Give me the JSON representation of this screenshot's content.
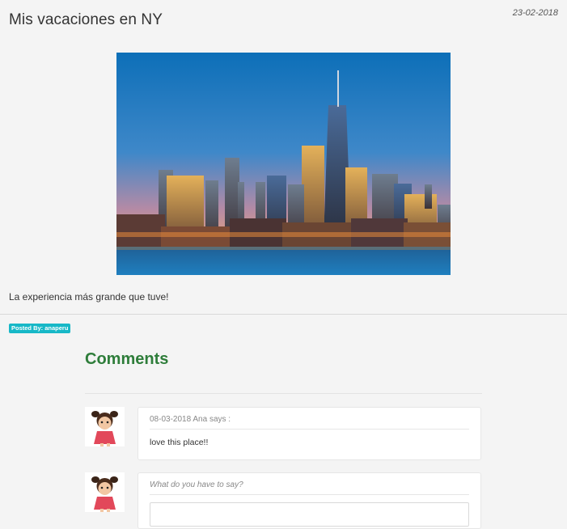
{
  "post": {
    "title": "Mis vacaciones en NY",
    "date": "23-02-2018",
    "image_alt": "New York City skyline at dusk",
    "body": "La experiencia más grande que tuve!",
    "posted_by": "Posted By: anaperu"
  },
  "comments": {
    "title": "Comments",
    "items": [
      {
        "meta": "08-03-2018 Ana says :",
        "text": "love this place!!"
      }
    ],
    "new_comment": {
      "prompt": "What do you have to say?"
    }
  },
  "colors": {
    "background": "#f4f4f4",
    "comments_title": "#2e7d3a",
    "badge": "#17b8c7"
  }
}
